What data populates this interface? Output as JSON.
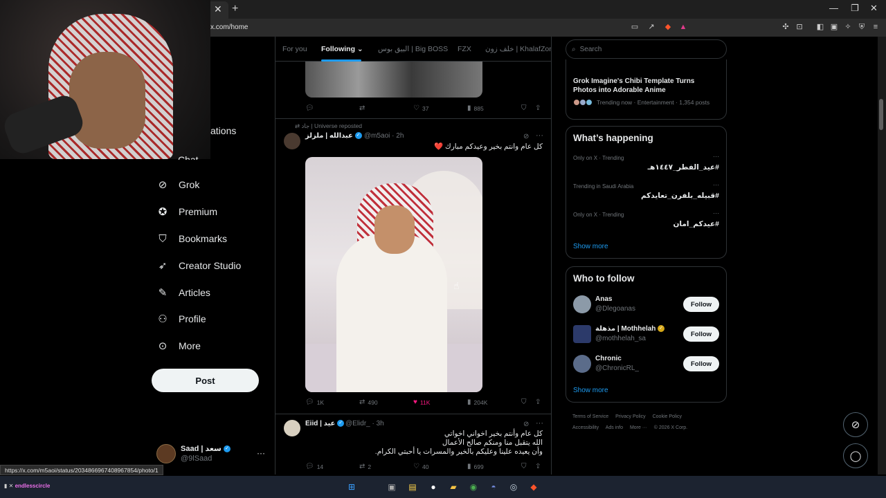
{
  "browser": {
    "url": "x.com/home",
    "status_url": "https://x.com/m5aoi/status/2034866967408967854/photo/1"
  },
  "nav": {
    "notifications_partial": "ations",
    "chat_partial": "Chat",
    "items": [
      {
        "label": "Grok",
        "icon": "grok-icon"
      },
      {
        "label": "Premium",
        "icon": "premium-icon"
      },
      {
        "label": "Bookmarks",
        "icon": "bookmark-icon"
      },
      {
        "label": "Creator Studio",
        "icon": "rocket-icon"
      },
      {
        "label": "Articles",
        "icon": "articles-icon"
      },
      {
        "label": "Profile",
        "icon": "profile-icon"
      },
      {
        "label": "More",
        "icon": "more-circle-icon"
      }
    ],
    "post_label": "Post"
  },
  "account": {
    "name": "Saad | سعد",
    "handle": "@9lSaad",
    "more": "···"
  },
  "feed": {
    "tabs": [
      "For you",
      "Following",
      "البيق بوس | Big BOSS",
      "FZX",
      "خلف زون | KhalafZone"
    ],
    "prev_tweet_actions": {
      "replies": "",
      "reposts": "",
      "likes": "37",
      "views": "885"
    },
    "tweet1": {
      "repost_note": "جاد | Universe reposted",
      "name": "عبدالله | ملزلز",
      "handle": "@m5aoi",
      "time": "· 2h",
      "text": "كل عام وانتم بخير وعيدكم مبارك ❤️",
      "actions": {
        "replies": "1K",
        "reposts": "490",
        "likes": "11K",
        "views": "204K"
      }
    },
    "tweet2": {
      "name": "Eiid | عيد",
      "handle": "@Elidr_",
      "time": "· 3h",
      "lines": [
        "كل عام وأنتم بخير اخواني اخواتي",
        "الله يتقبل منا ومنكم صالح الأعمال",
        "وأن يعيده علينا وعليكم بالخير والمسرات يا أحبتي الكرام."
      ],
      "actions": {
        "replies": "14",
        "reposts": "2",
        "likes": "40",
        "views": "699"
      }
    }
  },
  "sidebar": {
    "search_placeholder": "Search",
    "news": {
      "title": "Grok Imagine's Chibi Template Turns Photos into Adorable Anime",
      "meta": "Trending now · Entertainment · 1,354 posts"
    },
    "happening": {
      "title": "What’s happening",
      "trends": [
        {
          "meta": "Only on X · Trending",
          "name": "#عيد_الفطر_١٤٤٧هـ"
        },
        {
          "meta": "Trending in Saudi Arabia",
          "name": "#قبيله_بلفرن_تعايدكم"
        },
        {
          "meta": "Only on X · Trending",
          "name": "#عيدكم_امان"
        }
      ],
      "show_more": "Show more"
    },
    "who_to_follow": {
      "title": "Who to follow",
      "users": [
        {
          "name": "Anas",
          "handle": "@Dlegoanas",
          "button": "Follow"
        },
        {
          "name": "مذهلة | Mothhelah",
          "handle": "@mothhelah_sa",
          "button": "Follow"
        },
        {
          "name": "Chronic",
          "handle": "@ChronicRL_",
          "button": "Follow"
        }
      ],
      "show_more": "Show more"
    },
    "footer": [
      "Terms of Service",
      "Privacy Policy",
      "Cookie Policy",
      "Accessibility",
      "Ads info",
      "More ···",
      "© 2026 X Corp."
    ]
  },
  "taskbar": {
    "brand": "endlesscircle"
  },
  "colors": {
    "accent": "#1d9bf0",
    "like_active": "#f91880",
    "border": "#2f3336",
    "muted": "#71767b"
  }
}
